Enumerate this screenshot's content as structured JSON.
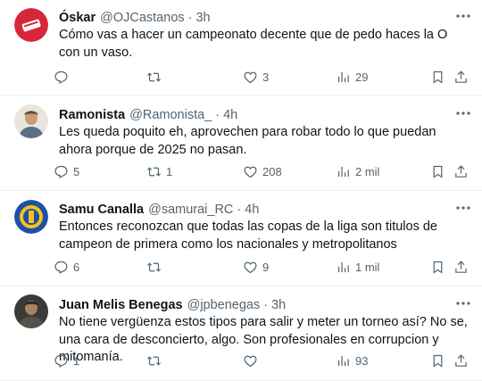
{
  "tweets": [
    {
      "name": "Óskar",
      "handle": "@OJCastanos",
      "sep": "·",
      "time": "3h",
      "text": "Cómo vas a hacer un campeonato decente que de pedo haces la O con un vaso.",
      "replies": "",
      "retweets": "",
      "likes": "3",
      "views": "29"
    },
    {
      "name": "Ramonista",
      "handle": "@Ramonista_",
      "sep": "·",
      "time": "4h",
      "text": "Les queda poquito eh, aprovechen para robar todo lo que puedan ahora porque de 2025 no pasan.",
      "replies": "5",
      "retweets": "1",
      "likes": "208",
      "views": "2 mil"
    },
    {
      "name": "Samu Canalla",
      "handle": "@samurai_RC",
      "sep": "·",
      "time": "4h",
      "text": "Entonces reconozcan que todas las copas de la liga son titulos de campeon de primera como los nacionales y metropolitanos",
      "replies": "6",
      "retweets": "",
      "likes": "9",
      "views": "1 mil"
    },
    {
      "name": "Juan Melis Benegas",
      "handle": "@jpbenegas",
      "sep": "·",
      "time": "3h",
      "text": "No tiene vergüenza estos tipos para salir y meter un torneo así? No se, una cara de desconcierto, algo. Son profesionales en corrupcion y mitomanía.",
      "replies": "1",
      "retweets": "",
      "likes": "",
      "views": "93"
    }
  ],
  "colors": {
    "text": "#0f1419",
    "secondary": "#536471",
    "divider": "#eff3f4",
    "avatar1_bg": "#d6263a",
    "avatar3_bg": "#1f4fa8"
  },
  "icons": [
    "more-icon",
    "reply-icon",
    "retweet-icon",
    "like-icon",
    "views-icon",
    "bookmark-icon",
    "share-icon"
  ]
}
